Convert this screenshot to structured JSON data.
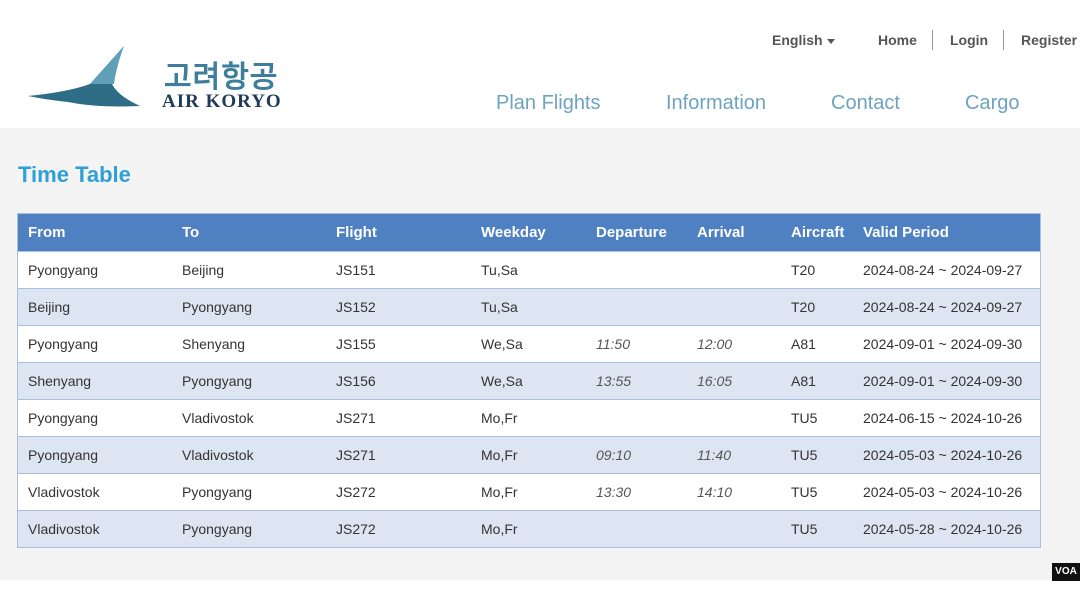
{
  "brand": {
    "korean": "고려항공",
    "english": "AIR KORYO"
  },
  "toplinks": {
    "language": "English",
    "home": "Home",
    "login": "Login",
    "register": "Register"
  },
  "nav": {
    "plan": "Plan Flights",
    "information": "Information",
    "contact": "Contact",
    "cargo": "Cargo"
  },
  "page": {
    "title": "Time Table"
  },
  "table": {
    "headers": [
      "From",
      "To",
      "Flight",
      "Weekday",
      "Departure",
      "Arrival",
      "Aircraft",
      "Valid Period"
    ],
    "rows": [
      [
        "Pyongyang",
        "Beijing",
        "JS151",
        "Tu,Sa",
        "",
        "",
        "T20",
        "2024-08-24 ~ 2024-09-27"
      ],
      [
        "Beijing",
        "Pyongyang",
        "JS152",
        "Tu,Sa",
        "",
        "",
        "T20",
        "2024-08-24 ~ 2024-09-27"
      ],
      [
        "Pyongyang",
        "Shenyang",
        "JS155",
        "We,Sa",
        "11:50",
        "12:00",
        "A81",
        "2024-09-01 ~ 2024-09-30"
      ],
      [
        "Shenyang",
        "Pyongyang",
        "JS156",
        "We,Sa",
        "13:55",
        "16:05",
        "A81",
        "2024-09-01 ~ 2024-09-30"
      ],
      [
        "Pyongyang",
        "Vladivostok",
        "JS271",
        "Mo,Fr",
        "",
        "",
        "TU5",
        "2024-06-15 ~ 2024-10-26"
      ],
      [
        "Pyongyang",
        "Vladivostok",
        "JS271",
        "Mo,Fr",
        "09:10",
        "11:40",
        "TU5",
        "2024-05-03 ~ 2024-10-26"
      ],
      [
        "Vladivostok",
        "Pyongyang",
        "JS272",
        "Mo,Fr",
        "13:30",
        "14:10",
        "TU5",
        "2024-05-03 ~ 2024-10-26"
      ],
      [
        "Vladivostok",
        "Pyongyang",
        "JS272",
        "Mo,Fr",
        "",
        "",
        "TU5",
        "2024-05-28 ~ 2024-10-26"
      ]
    ]
  },
  "watermark": "VOA",
  "colors": {
    "accent": "#2f9fd6",
    "header_row": "#4f81c2",
    "nav": "#6ea3c0",
    "row_alt": "#dce5f1"
  }
}
